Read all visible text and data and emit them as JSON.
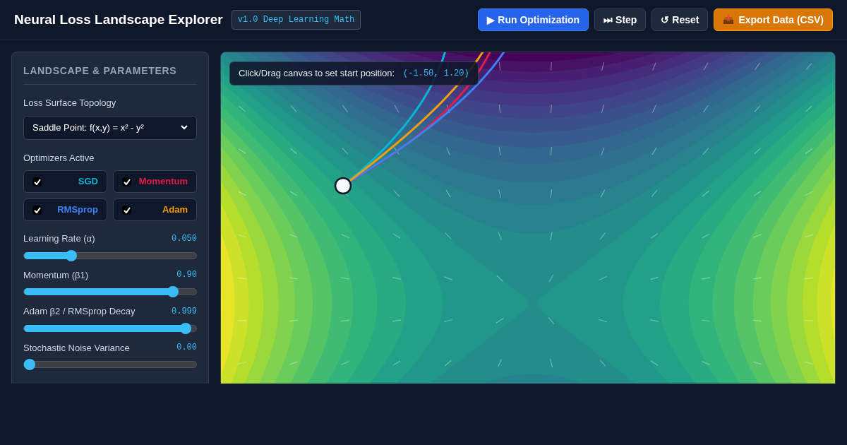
{
  "header": {
    "title": "Neural Loss Landscape Explorer",
    "badge": "v1.0 Deep Learning Math",
    "buttons": [
      {
        "label": "▶ Run Optimization",
        "kind": "primary"
      },
      {
        "label": "⏭ Step",
        "kind": "secondary"
      },
      {
        "label": "↺ Reset",
        "kind": "secondary"
      },
      {
        "label": "Export Data (CSV)",
        "kind": "export"
      }
    ]
  },
  "sidebar": {
    "title": "LANDSCAPE & PARAMETERS",
    "topology_label": "Loss Surface Topology",
    "topology_value": "Saddle Point: f(x,y) = x² - y²",
    "optimizers_label": "Optimizers Active",
    "optimizers": [
      {
        "name": "SGD",
        "color": "#06b6d4",
        "checked": true
      },
      {
        "name": "Momentum",
        "color": "#e11d48",
        "checked": true
      },
      {
        "name": "RMSprop",
        "color": "#3b82f6",
        "checked": true
      },
      {
        "name": "Adam",
        "color": "#f59e0b",
        "checked": true
      }
    ],
    "sliders": [
      {
        "label": "Learning Rate (α)",
        "value": "0.050",
        "level": 0.26
      },
      {
        "label": "Momentum (β1)",
        "value": "0.90",
        "level": 0.89
      },
      {
        "label": "Adam β2 / RMSprop Decay",
        "value": "0.999",
        "level": 0.97
      },
      {
        "label": "Stochastic Noise Variance",
        "value": "0.00",
        "level": 0
      }
    ]
  },
  "canvas": {
    "hint": "Click/Drag canvas to set start position:",
    "coords": "(-1.50, 1.20)"
  }
}
